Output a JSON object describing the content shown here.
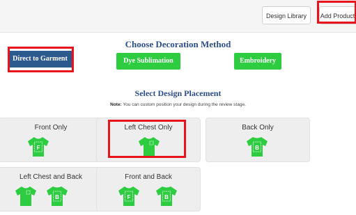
{
  "toolbar": {
    "design_library": "Design Library",
    "add_product": "Add Product"
  },
  "decoration": {
    "title": "Choose Decoration Method",
    "methods": [
      "Direct to Garment",
      "Dye Sublimation",
      "Embroidery"
    ],
    "selected": "Direct to Garment",
    "colors": {
      "dtg": "#2d5a8e",
      "option": "#2ecc40",
      "title": "#2b4d8c"
    }
  },
  "placement": {
    "title": "Select Design Placement",
    "note_label": "Note:",
    "note_text": " You can custom position your design during the review stage.",
    "options": [
      {
        "label": "Front Only",
        "marks": [
          "F"
        ]
      },
      {
        "label": "Left Chest Only",
        "marks": [
          ""
        ]
      },
      {
        "label": "Back Only",
        "marks": [
          "B"
        ]
      },
      {
        "label": "Left Chest and Back",
        "marks": [
          "",
          "B"
        ]
      },
      {
        "label": "Front and Back",
        "marks": [
          "F",
          "B"
        ]
      }
    ],
    "selected": "Left Chest Only",
    "shirt_color": "#2ecc40",
    "highlight_color": "#e8131b"
  }
}
